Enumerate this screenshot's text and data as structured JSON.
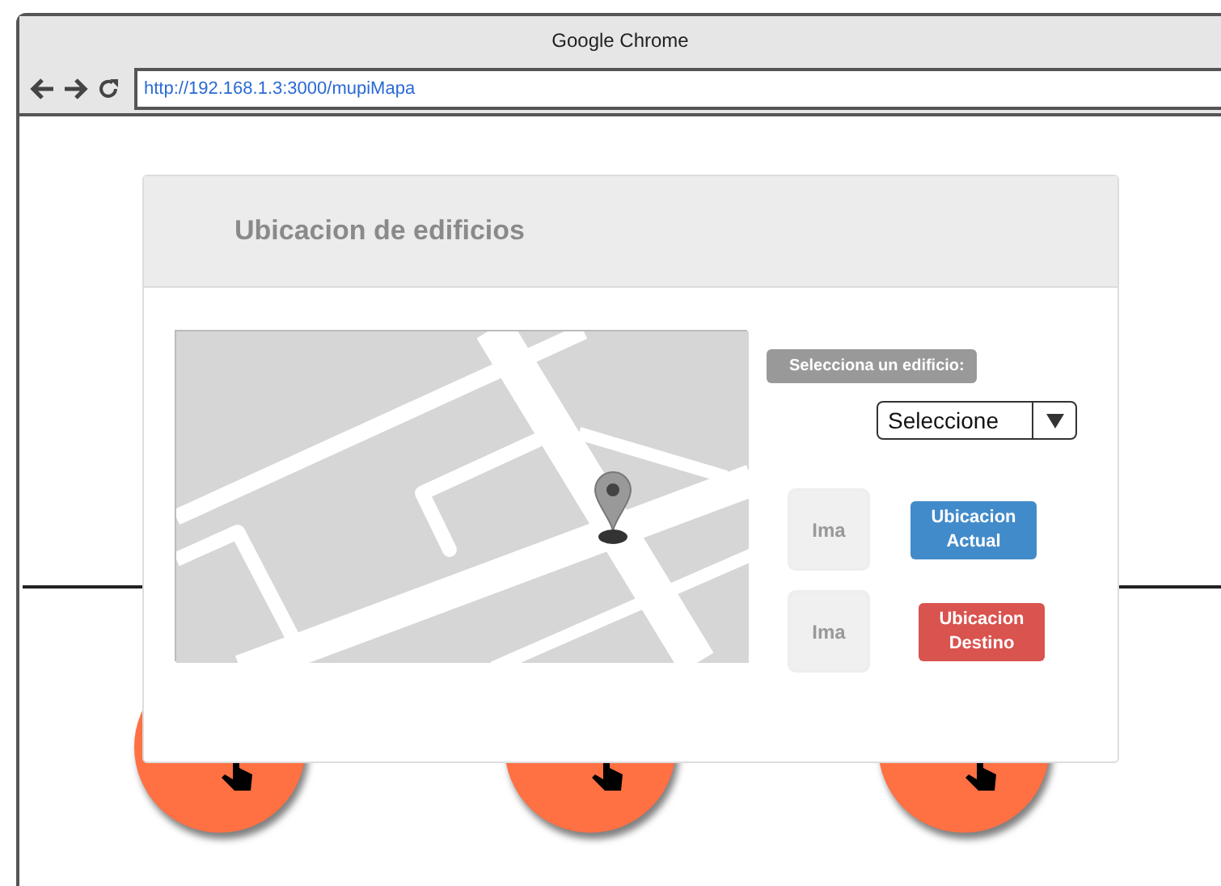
{
  "window": {
    "title": "Google Chrome"
  },
  "address_bar": {
    "url": "http://192.168.1.3:3000/mupiMapa"
  },
  "background": {
    "tiles": [
      {
        "kind": "hand"
      },
      {
        "kind": "hand"
      },
      {
        "kind": "hand"
      }
    ]
  },
  "dialog": {
    "title": "Ubicacion de edificios",
    "select_label": "Selecciona un edificio:",
    "select": {
      "value": "Seleccione"
    },
    "rows": [
      {
        "image_text": "Ima",
        "button": {
          "label": "Ubicacion Actual",
          "color": "#428bca"
        }
      },
      {
        "image_text": "Ima",
        "button": {
          "label": "Ubicacion Destino",
          "color": "#d9534f"
        }
      }
    ]
  }
}
